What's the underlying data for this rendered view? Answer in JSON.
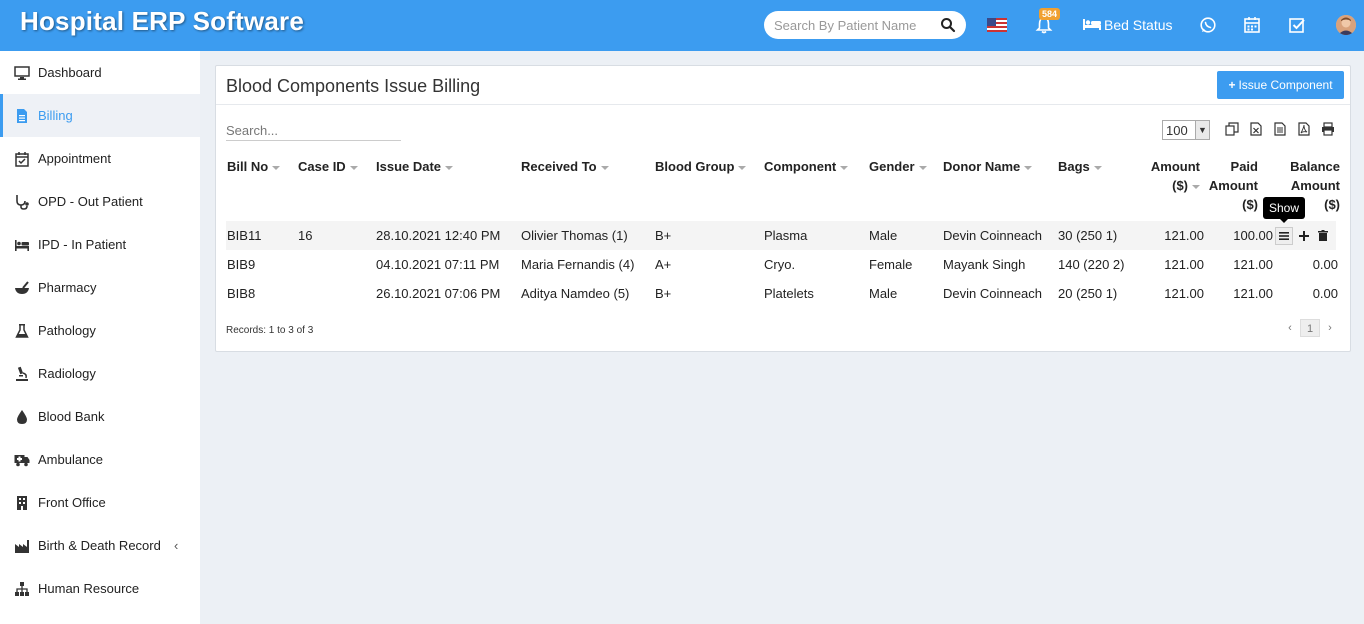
{
  "app": {
    "title": "Hospital ERP Software"
  },
  "header": {
    "search_placeholder": "Search By Patient Name",
    "notification_count": "584",
    "bed_status_label": "Bed Status"
  },
  "sidebar": {
    "items": [
      {
        "label": "Dashboard",
        "icon": "monitor-icon"
      },
      {
        "label": "Billing",
        "icon": "file-icon",
        "active": true
      },
      {
        "label": "Appointment",
        "icon": "calendar-check-icon"
      },
      {
        "label": "OPD - Out Patient",
        "icon": "stethoscope-icon"
      },
      {
        "label": "IPD - In Patient",
        "icon": "bed-icon"
      },
      {
        "label": "Pharmacy",
        "icon": "mortar-pestle-icon"
      },
      {
        "label": "Pathology",
        "icon": "flask-icon"
      },
      {
        "label": "Radiology",
        "icon": "microscope-icon"
      },
      {
        "label": "Blood Bank",
        "icon": "tint-icon"
      },
      {
        "label": "Ambulance",
        "icon": "ambulance-icon"
      },
      {
        "label": "Front Office",
        "icon": "building-icon"
      },
      {
        "label": "Birth & Death Record",
        "icon": "industry-icon",
        "expandable": true
      },
      {
        "label": "Human Resource",
        "icon": "sitemap-icon"
      }
    ]
  },
  "page": {
    "title": "Blood Components Issue Billing",
    "issue_button_label": "Issue Component",
    "search_placeholder": "Search...",
    "page_size": "100",
    "columns": {
      "bill_no": "Bill No",
      "case_id": "Case ID",
      "issue_date": "Issue Date",
      "received_to": "Received To",
      "blood_group": "Blood Group",
      "component": "Component",
      "gender": "Gender",
      "donor_name": "Donor Name",
      "bags": "Bags",
      "amount_1": "Amount",
      "amount_2": "($)",
      "paid_1": "Paid",
      "paid_2": "Amount",
      "paid_3": "($)",
      "balance_1": "Balance",
      "balance_2": "Amount",
      "balance_3": "($)"
    },
    "rows": [
      {
        "bill_no": "BIB11",
        "case_id": "16",
        "issue_date": "28.10.2021 12:40 PM",
        "received_to": "Olivier Thomas (1)",
        "blood_group": "B+",
        "component": "Plasma",
        "gender": "Male",
        "donor_name": "Devin Coinneach",
        "bags": "30 (250 1)",
        "amount": "121.00",
        "paid": "100.00",
        "balance": ""
      },
      {
        "bill_no": "BIB9",
        "case_id": "",
        "issue_date": "04.10.2021 07:11 PM",
        "received_to": "Maria Fernandis (4)",
        "blood_group": "A+",
        "component": "Cryo.",
        "gender": "Female",
        "donor_name": "Mayank Singh",
        "bags": "140 (220 2)",
        "amount": "121.00",
        "paid": "121.00",
        "balance": "0.00"
      },
      {
        "bill_no": "BIB8",
        "case_id": "",
        "issue_date": "26.10.2021 07:06 PM",
        "received_to": "Aditya Namdeo (5)",
        "blood_group": "B+",
        "component": "Platelets",
        "gender": "Male",
        "donor_name": "Devin Coinneach",
        "bags": "20 (250 1)",
        "amount": "121.00",
        "paid": "121.00",
        "balance": "0.00"
      }
    ],
    "tooltip": "Show",
    "records_text": "Records: 1 to 3 of 3",
    "current_page": "1"
  },
  "colors": {
    "brand": "#3c9cf0",
    "badge": "#f0a030"
  }
}
